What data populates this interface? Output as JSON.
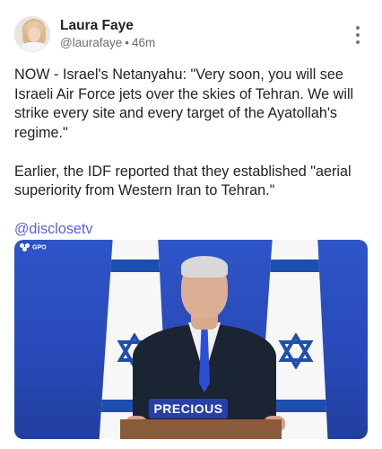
{
  "post": {
    "author_name": "Laura Faye",
    "handle": "@laurafaye",
    "separator": "•",
    "time": "46m",
    "paragraphs": [
      "NOW - Israel's Netanyahu: \"Very soon, you will see Israeli Air Force jets over the skies of Tehran. We will strike every site and every target of the Ayatollah's regime.\"",
      "Earlier, the IDF reported that they established \"aerial superiority from Western Iran to Tehran.\""
    ],
    "mention": "@disclosetv",
    "media": {
      "watermark": "GPO",
      "podium_sign": "PRECIOUS"
    }
  },
  "icons": {
    "more": "more-vertical-icon"
  },
  "colors": {
    "link": "#5b5fe0",
    "meta": "#6e6e6e",
    "background": "#ffffff"
  }
}
